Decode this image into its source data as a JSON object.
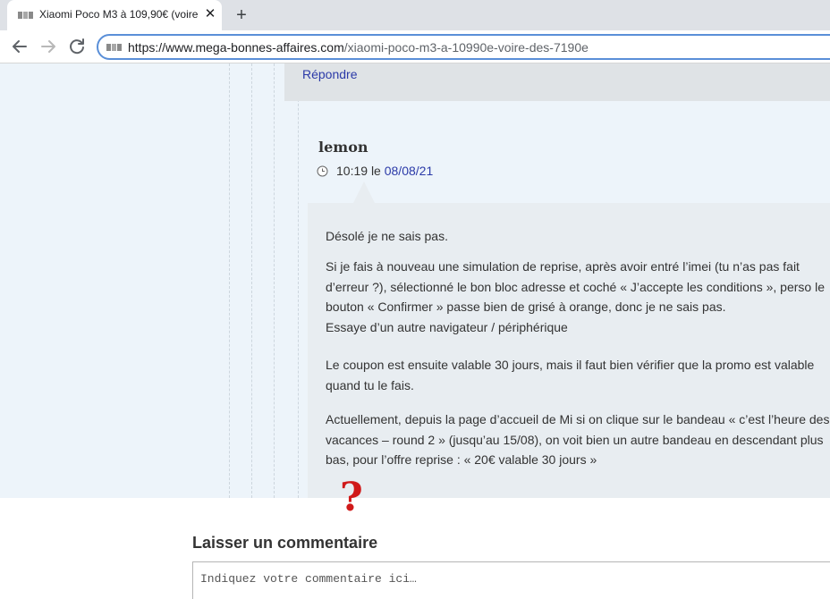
{
  "browser": {
    "tab_title": "Xiaomi Poco M3 à 109,90€ (voire",
    "tab_close_glyph": "✕",
    "new_tab_glyph": "+",
    "url_host": "https://www.mega-bonnes-affaires.com",
    "url_path": "/xiaomi-poco-m3-a-10990e-voire-des-7190e",
    "icons": {
      "favicon": "site-favicon-icon",
      "back": "back-arrow-icon",
      "forward": "forward-arrow-icon",
      "reload": "reload-icon"
    }
  },
  "parent_comment": {
    "reply_label": "Répondre"
  },
  "comment": {
    "author": "lemon",
    "time": "10:19",
    "date_prefix": "le",
    "date": "08/08/21",
    "icon": "clock-icon",
    "paragraphs": [
      "Désolé je ne sais pas.",
      "Si je fais à nouveau une simulation de reprise, après avoir entré l’imei (tu n’as pas fait d’erreur ?), sélectionné le bon bloc adresse et coché « J’accepte les conditions », perso le bouton « Confirmer » passe bien de grisé à orange, donc je ne sais pas.",
      "Essaye d’un autre navigateur / périphérique",
      "Le coupon est ensuite valable 30 jours, mais il faut bien vérifier que la promo est valable quand tu le fais.",
      "Actuellement, depuis la page d’accueil de Mi si on clique sur le bandeau « c’est l’heure des vacances – round 2 » (jusqu’au 15/08), on voit bien un autre bandeau en descendant plus bas, pour l’offre reprise : « 20€ valable 30 jours »"
    ]
  },
  "annotation": {
    "mark": "?",
    "color": "#d01a1a"
  },
  "comment_form": {
    "title": "Laisser un commentaire",
    "placeholder": "Indiquez votre commentaire ici…"
  },
  "colors": {
    "link": "#2b3aa8",
    "omnibox_border": "#5a8fd8",
    "page_background": "#edf4fa",
    "bubble": "#e8edf1"
  }
}
